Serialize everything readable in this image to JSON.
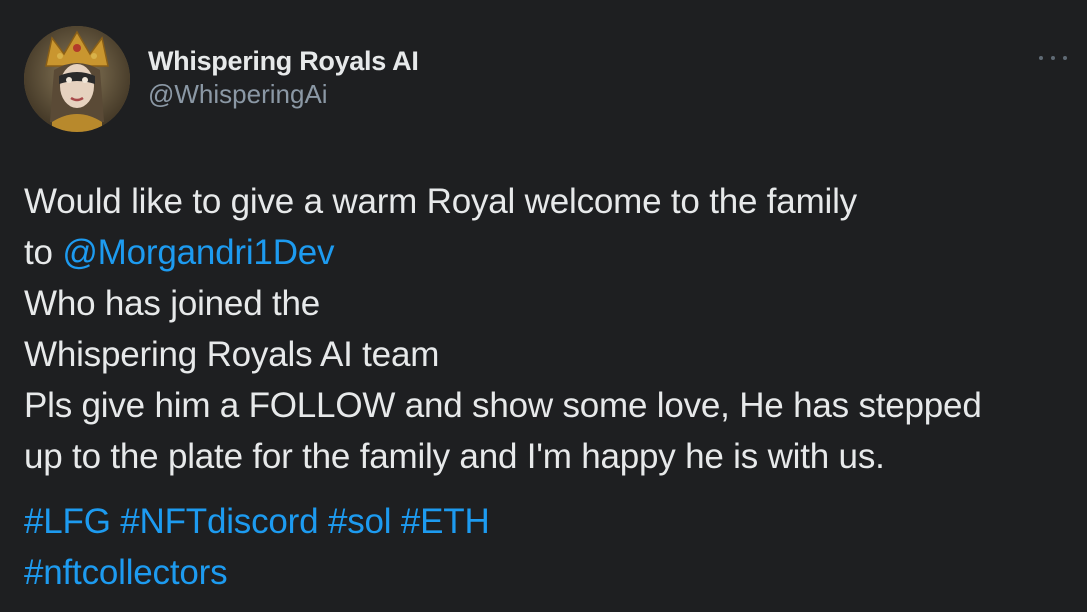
{
  "author": {
    "display_name": "Whispering Royals AI",
    "handle": "@WhisperingAi",
    "avatar_icon": "crowned-woman-avatar"
  },
  "more_icon": "ellipsis-icon",
  "tweet": {
    "line1": "Would like to give a warm Royal welcome to the family",
    "line2_prefix": "to ",
    "mention": "@Morgandri1Dev",
    "line3": "Who has joined the",
    "line4": "Whispering Royals AI team",
    "line5": "Pls give him a FOLLOW and show some love, He has stepped",
    "line6": "up to the plate for the family and I'm happy he is with us."
  },
  "hashtags": {
    "row1": [
      "#LFG",
      "#NFTdiscord",
      "#sol",
      "#ETH"
    ],
    "row2": [
      "#nftcollectors"
    ]
  },
  "colors": {
    "background": "#1e1f21",
    "text": "#e7e9ea",
    "secondary": "#8b98a5",
    "link": "#1d9bf0"
  }
}
